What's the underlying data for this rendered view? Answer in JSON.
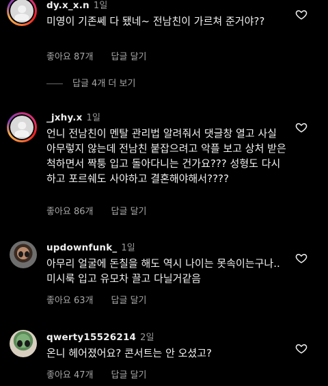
{
  "comments": [
    {
      "username": "dy.x_x.n",
      "time": "1일",
      "text": "미영이 기존쎄 다 됐네~ 전남친이 가르쳐 준거야??",
      "likes": "좋아요 87개",
      "reply_label": "답글 달기",
      "view_replies": "답글 4개 더 보기"
    },
    {
      "username": "_jxhy.x",
      "time": "1일",
      "text": "언니 전남친이 멘탈 관리법 알려줘서 댓글창 열고 사실 아무렇지 않는데 전남친 붙잡으려고 악플 보고 상처 받은척하면서 짝퉁 입고 돌아다니는 건가요??? 성형도 다시하고 포르쉐도 사야하고 결혼해야해서????",
      "likes": "좋아요 86개",
      "reply_label": "답글 달기"
    },
    {
      "username": "updownfunk_",
      "time": "1일",
      "text": "아무리 얼굴에 돈칠을 해도 역시 나이는 못속이는구나.. 미시룩 입고 유모차 끌고 다닐거같음",
      "likes": "좋아요 63개",
      "reply_label": "답글 달기"
    },
    {
      "username": "qwerty15526214",
      "time": "2일",
      "text": "온니 헤어졌어요? 콘서트는 안 오셨고?",
      "likes": "좋아요 47개",
      "reply_label": "답글 달기"
    }
  ],
  "colors": {
    "background": "#000000",
    "text": "#f2f2f2",
    "muted": "#a8a8a8",
    "story_ring": "#e1306c"
  }
}
